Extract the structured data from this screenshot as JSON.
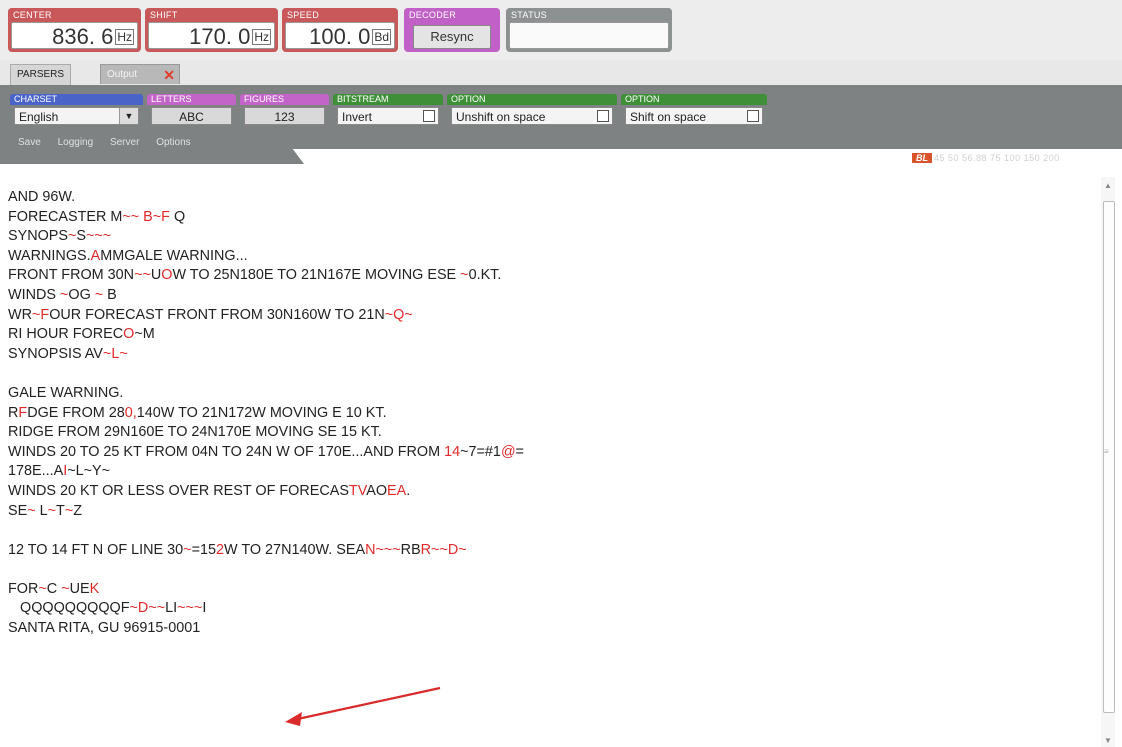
{
  "top": {
    "center": {
      "caption": "CENTER",
      "value": "836. 6",
      "unit": "Hz"
    },
    "shift": {
      "caption": "SHIFT",
      "value": "170. 0",
      "unit": "Hz"
    },
    "speed": {
      "caption": "SPEED",
      "value": "100. 0",
      "unit": "Bd"
    },
    "decoder": {
      "caption": "DECODER",
      "button": "Resync"
    },
    "status": {
      "caption": "STATUS",
      "value": ""
    }
  },
  "tabs": {
    "parsers": "PARSERS",
    "output": "Output",
    "close": "✕"
  },
  "parser": {
    "charset": {
      "caption": "CHARSET",
      "value": "English",
      "arrow": "▼"
    },
    "letters": {
      "caption": "LETTERS",
      "button": "ABC"
    },
    "figures": {
      "caption": "FIGURES",
      "button": "123"
    },
    "bitstream": {
      "caption": "BITSTREAM",
      "label": "Invert"
    },
    "option1": {
      "caption": "OPTION",
      "label": "Unshift on space"
    },
    "option2": {
      "caption": "OPTION",
      "label": "Shift on space"
    },
    "subnav": [
      "Save",
      "Logging",
      "Server",
      "Options"
    ]
  },
  "ratebar": {
    "badge": "BL",
    "rates": "45 50 56.88 75 100 150 200"
  },
  "colors": {
    "accent_red": "#e02a2a",
    "arrow": "#d92b2b"
  },
  "output_lines": [
    [
      {
        "t": "AND 96W."
      }
    ],
    [
      {
        "t": "FORECASTER M"
      },
      {
        "t": "~~ B~F",
        "r": true
      },
      {
        "t": " Q"
      }
    ],
    [
      {
        "t": "SYNOPS"
      },
      {
        "t": "~",
        "r": true
      },
      {
        "t": "S"
      },
      {
        "t": "~~~",
        "r": true
      }
    ],
    [
      {
        "t": "WARNINGS."
      },
      {
        "t": "A",
        "r": true
      },
      {
        "t": "MMGALE WARNING..."
      }
    ],
    [
      {
        "t": "FRONT FROM 30N"
      },
      {
        "t": "~~",
        "r": true
      },
      {
        "t": "U"
      },
      {
        "t": "O",
        "r": true
      },
      {
        "t": "W TO 25N180E TO 21N167E MOVING ESE "
      },
      {
        "t": "~",
        "r": true
      },
      {
        "t": "0.KT."
      }
    ],
    [
      {
        "t": "WINDS "
      },
      {
        "t": "~",
        "r": true
      },
      {
        "t": "OG "
      },
      {
        "t": "~",
        "r": true
      },
      {
        "t": " B"
      }
    ],
    [
      {
        "t": "WR"
      },
      {
        "t": "~F",
        "r": true
      },
      {
        "t": "OUR FORECAST FRONT FROM 30N160W TO 21N"
      },
      {
        "t": "~Q~",
        "r": true
      }
    ],
    [
      {
        "t": "RI HOUR FOREC"
      },
      {
        "t": "O",
        "r": true
      },
      {
        "t": "~M"
      }
    ],
    [
      {
        "t": "SYNOPSIS AV"
      },
      {
        "t": "~L~",
        "r": true
      }
    ],
    [
      {
        "t": ""
      }
    ],
    [
      {
        "t": "GALE WARNING."
      }
    ],
    [
      {
        "t": "R"
      },
      {
        "t": "F",
        "r": true
      },
      {
        "t": "DGE FROM 28"
      },
      {
        "t": "0,",
        "r": true
      },
      {
        "t": "140W TO 21N172W MOVING E 10 KT."
      }
    ],
    [
      {
        "t": "RIDGE FROM 29N160E TO 24N170E MOVING SE 15 KT."
      }
    ],
    [
      {
        "t": "WINDS 20 TO 25 KT FROM 04N TO 24N W OF 170E...AND FROM "
      },
      {
        "t": "14",
        "r": true
      },
      {
        "t": "~7=#1"
      },
      {
        "t": "@",
        "r": true
      },
      {
        "t": "="
      }
    ],
    [
      {
        "t": "178E...A"
      },
      {
        "t": "I",
        "r": true
      },
      {
        "t": "~L~Y~"
      }
    ],
    [
      {
        "t": "WINDS 20 KT OR LESS OVER REST OF FORECAS"
      },
      {
        "t": "TV",
        "r": true
      },
      {
        "t": "AO"
      },
      {
        "t": "EA",
        "r": true
      },
      {
        "t": "."
      }
    ],
    [
      {
        "t": "SE"
      },
      {
        "t": "~",
        "r": true
      },
      {
        "t": " L"
      },
      {
        "t": "~",
        "r": true
      },
      {
        "t": "T"
      },
      {
        "t": "~",
        "r": true
      },
      {
        "t": "Z"
      }
    ],
    [
      {
        "t": ""
      }
    ],
    [
      {
        "t": "12 TO 14 FT N OF LINE 30"
      },
      {
        "t": "~",
        "r": true
      },
      {
        "t": "=15"
      },
      {
        "t": "2",
        "r": true
      },
      {
        "t": "W TO 27N140W. SEA"
      },
      {
        "t": "N~~~",
        "r": true
      },
      {
        "t": "RB"
      },
      {
        "t": "R~~D~",
        "r": true
      }
    ],
    [
      {
        "t": ""
      }
    ],
    [
      {
        "t": "FOR"
      },
      {
        "t": "~",
        "r": true
      },
      {
        "t": "C "
      },
      {
        "t": "~",
        "r": true
      },
      {
        "t": "UE"
      },
      {
        "t": "K",
        "r": true
      }
    ],
    [
      {
        "t": "   QQQQQQQQQF"
      },
      {
        "t": "~D~~",
        "r": true
      },
      {
        "t": "LI"
      },
      {
        "t": "~~~",
        "r": true
      },
      {
        "t": "I"
      }
    ],
    [
      {
        "t": "SANTA RITA, GU 96915-0001"
      }
    ]
  ]
}
